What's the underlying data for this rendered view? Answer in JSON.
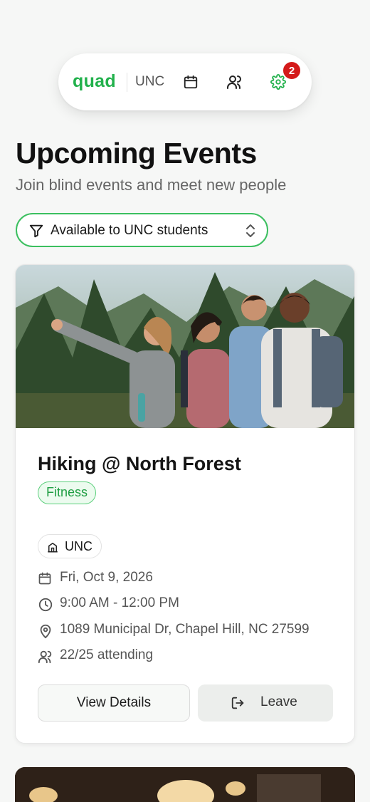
{
  "nav": {
    "logo": "quad",
    "school": "UNC",
    "notification_count": "2",
    "icons": [
      "calendar-icon",
      "people-icon",
      "gear-icon"
    ],
    "accent": "#22b14c",
    "badge_color": "#d41a1a"
  },
  "header": {
    "title": "Upcoming Events",
    "subtitle": "Join blind events and meet new people"
  },
  "filter": {
    "label": "Available to UNC students"
  },
  "events": [
    {
      "title": "Hiking @ North Forest",
      "category": "Fitness",
      "school": "UNC",
      "date": "Fri, Oct 9, 2026",
      "time": "9:00 AM - 12:00 PM",
      "location": "1089 Municipal Dr, Chapel Hill, NC 27599",
      "attendance": "22/25 attending",
      "view_label": "View Details",
      "leave_label": "Leave"
    }
  ]
}
